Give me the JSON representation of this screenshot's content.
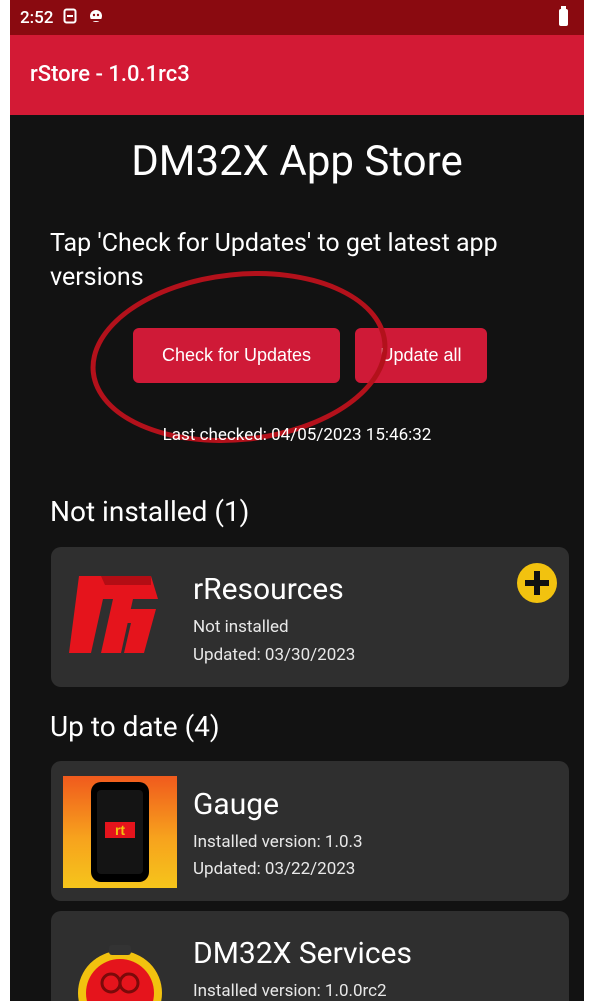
{
  "status_bar": {
    "time": "2:52",
    "icons": [
      "sim-icon",
      "android-debug-icon",
      "battery-icon"
    ]
  },
  "app_bar": {
    "title": "rStore - 1.0.1rc3"
  },
  "main": {
    "store_title": "DM32X App Store",
    "instructions": "Tap 'Check for Updates' to get latest app versions",
    "check_updates_label": "Check for Updates",
    "update_all_label": "Update all",
    "last_checked": "Last checked: 04/05/2023 15:46:32"
  },
  "sections": {
    "not_installed": {
      "heading": "Not installed (1)",
      "apps": [
        {
          "name": "rResources",
          "line1": "Not installed",
          "line2": "Updated: 03/30/2023",
          "icon": "rresources-logo-icon",
          "action_icon": "add-icon"
        }
      ]
    },
    "up_to_date": {
      "heading": "Up to date (4)",
      "apps": [
        {
          "name": "Gauge",
          "line1": "Installed version: 1.0.3",
          "line2": "Updated: 03/22/2023",
          "icon": "gauge-app-icon"
        },
        {
          "name": "DM32X Services",
          "line1": "Installed version: 1.0.0rc2",
          "icon": "dm32x-services-icon"
        }
      ]
    }
  },
  "colors": {
    "status_bar": "#8a0a10",
    "app_bar": "#d31a35",
    "button": "#cf1a37",
    "card": "#2f2f2f",
    "background": "#121212",
    "add_icon": "#f2c20f",
    "annotation_circle": "#b3111b"
  },
  "texts": {
    "gauge_logo_text": "rt"
  }
}
